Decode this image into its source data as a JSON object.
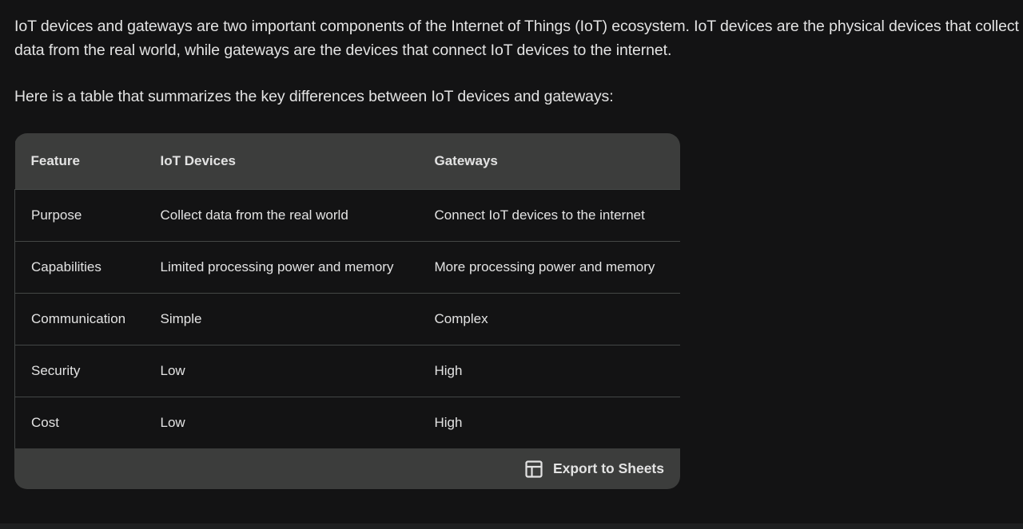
{
  "intro": {
    "paragraph1": "IoT devices and gateways are two important components of the Internet of Things (IoT) ecosystem. IoT devices are the physical devices that collect data from the real world, while gateways are the devices that connect IoT devices to the internet.",
    "paragraph2": "Here is a table that summarizes the key differences between IoT devices and gateways:"
  },
  "table": {
    "headers": [
      "Feature",
      "IoT Devices",
      "Gateways"
    ],
    "rows": [
      [
        "Purpose",
        "Collect data from the real world",
        "Connect IoT devices to the internet"
      ],
      [
        "Capabilities",
        "Limited processing power and memory",
        "More processing power and memory"
      ],
      [
        "Communication",
        "Simple",
        "Complex"
      ],
      [
        "Security",
        "Low",
        "High"
      ],
      [
        "Cost",
        "Low",
        "High"
      ]
    ]
  },
  "footer": {
    "export_label": "Export to Sheets",
    "export_icon": "sheets-table-icon"
  }
}
